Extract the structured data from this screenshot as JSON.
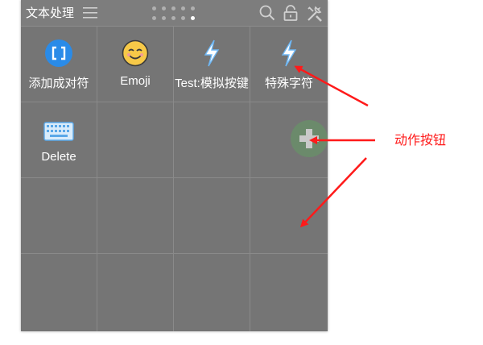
{
  "header": {
    "title": "文本处理",
    "page_indicator": {
      "total_dots": 10,
      "active_index": 9
    },
    "tools": [
      "search-icon",
      "lock-icon",
      "tools-icon"
    ]
  },
  "grid": {
    "columns": 4,
    "rows": 4,
    "items": [
      {
        "label": "添加成对符",
        "icon": "brackets-icon"
      },
      {
        "label": "Emoji",
        "icon": "smiley-icon"
      },
      {
        "label": "Test:模拟按键",
        "icon": "lightning-icon"
      },
      {
        "label": "特殊字符",
        "icon": "lightning-icon"
      },
      {
        "label": "Delete",
        "icon": "keyboard-icon"
      }
    ],
    "add_button_icon": "plus-icon"
  },
  "annotation": {
    "text": "动作按钮",
    "color": "#ff1a1a"
  },
  "colors": {
    "panel": "#757575",
    "accent_blue": "#2a8be8",
    "add_button": "#6b8a6b"
  }
}
